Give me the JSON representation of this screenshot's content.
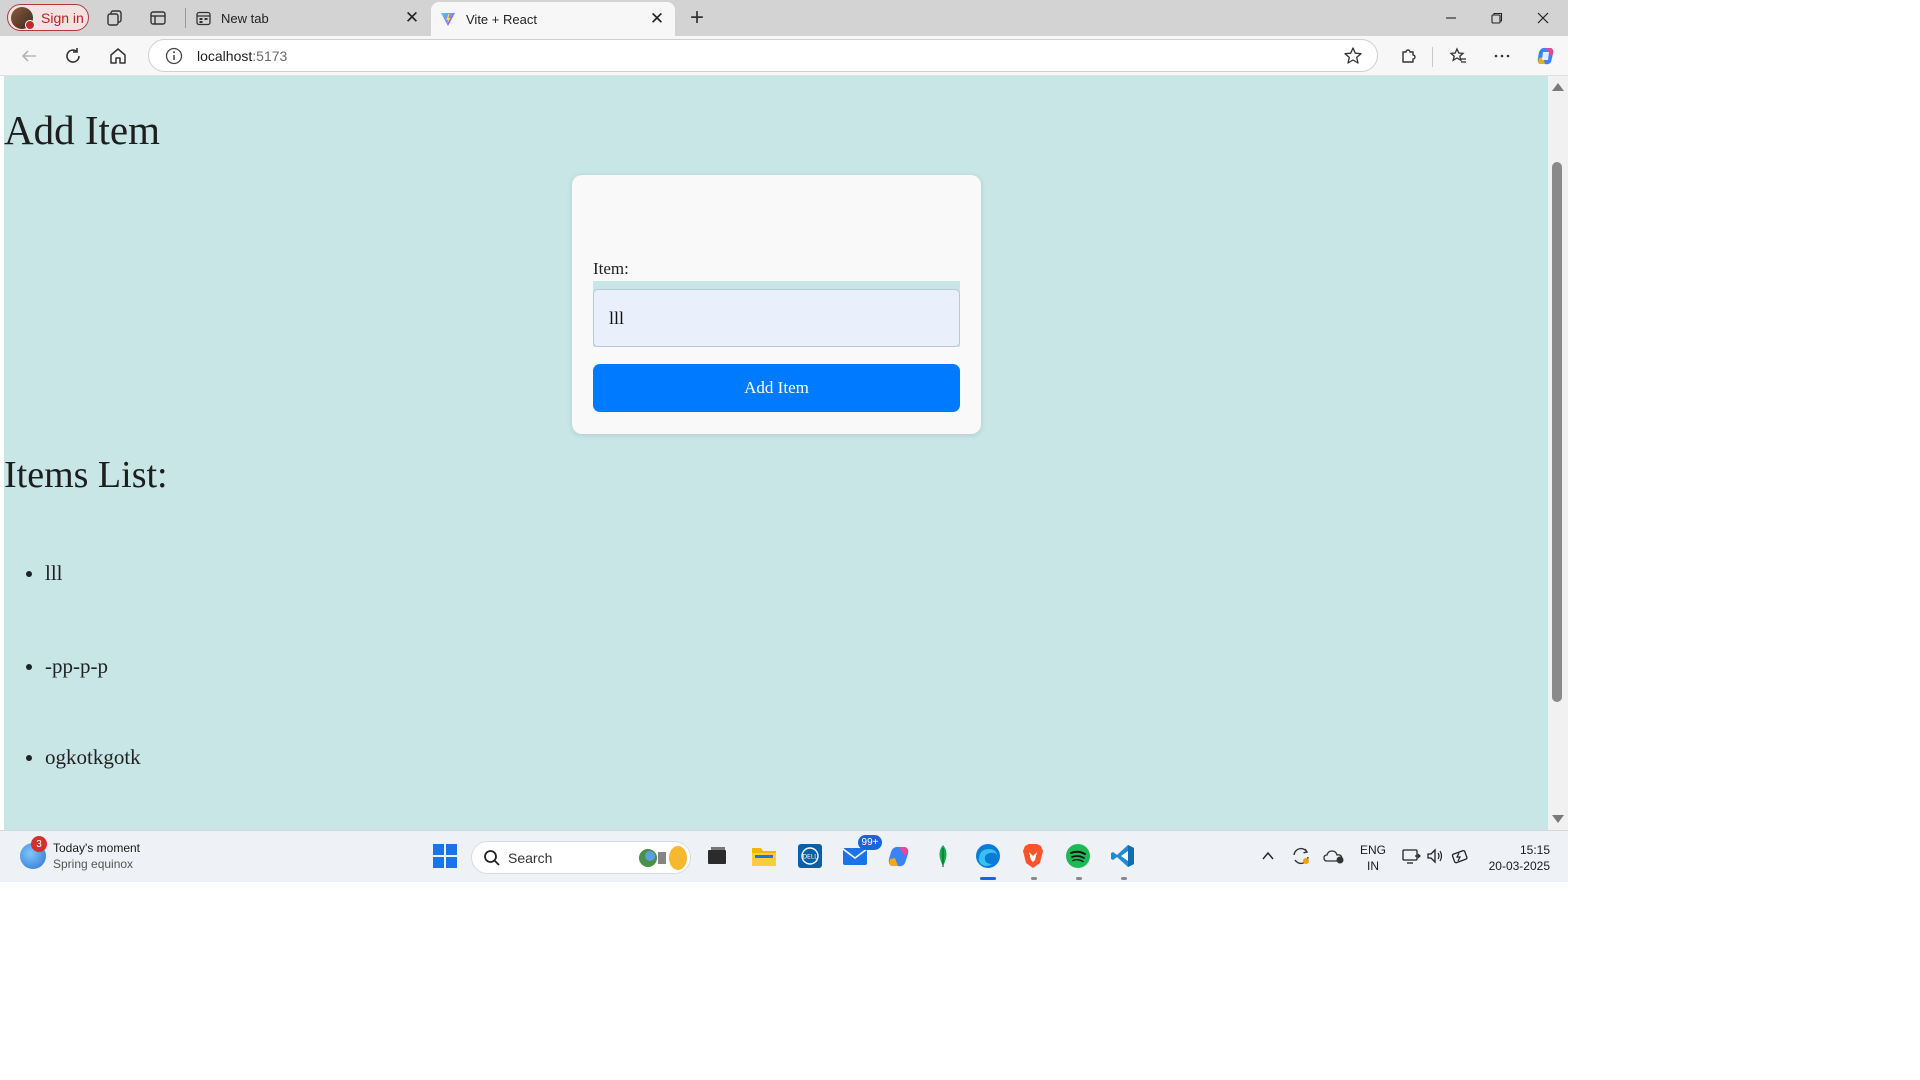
{
  "browser": {
    "signin_label": "Sign in",
    "tabs": [
      {
        "title": "New tab",
        "favicon": "newtab-icon",
        "active": false
      },
      {
        "title": "Vite + React",
        "favicon": "vite-icon",
        "active": true
      }
    ],
    "url_host": "localhost",
    "url_port": ":5173"
  },
  "page": {
    "title": "Add Item",
    "form": {
      "label": "Item:",
      "value": "lll",
      "button_label": "Add Item"
    },
    "list_title": "Items List:",
    "items": [
      "lll",
      "-pp-p-p",
      "ogkotkgotk"
    ]
  },
  "taskbar": {
    "weather_badge": "3",
    "weather_title": "Today's moment",
    "weather_subtitle": "Spring equinox",
    "search_label": "Search",
    "mail_badge": "99+",
    "lang_top": "ENG",
    "lang_bottom": "IN",
    "time": "15:15",
    "date": "20-03-2025"
  },
  "colors": {
    "page_background": "#c8e6e6",
    "button": "#007bff",
    "input_background": "#eaf0fb"
  }
}
